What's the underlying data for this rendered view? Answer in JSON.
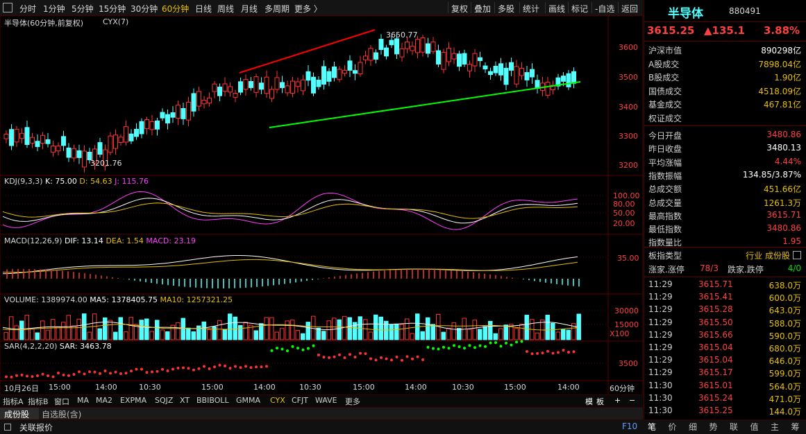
{
  "toolbar": {
    "left": [
      "分时",
      "1分钟",
      "5分钟",
      "15分钟",
      "30分钟",
      "60分钟",
      "日线",
      "周线",
      "月线",
      "多周期",
      "更多 〉"
    ],
    "active_index": 5,
    "right": [
      "复权",
      "叠加",
      "多股",
      "统计",
      "画线",
      "标记",
      "-自选",
      "返回"
    ]
  },
  "chart": {
    "title": "半导体(60分钟,前复权)",
    "indicator": "CYX(7)",
    "high_label": "3650.77",
    "low_label": "3201.76",
    "price_ticks": [
      "3600",
      "3500",
      "3400",
      "3300",
      "3200"
    ],
    "kdj": {
      "name": "KDJ(9,3,3)",
      "k": "K: 75.00",
      "d": "D: 54.63",
      "j": "J: 115.76",
      "ticks": [
        "100.00",
        "80.00",
        "50.00",
        "20.00"
      ]
    },
    "macd": {
      "name": "MACD(12,26,9)",
      "dif": "DIF: 13.14",
      "dea": "DEA: 1.54",
      "macd": "MACD: 23.19",
      "ticks": [
        "35.00"
      ]
    },
    "volume": {
      "name": "VOLUME: 1389974.00",
      "ma5": "MA5: 1378405.75",
      "ma10": "MA10: 1257321.25",
      "ticks": [
        "30000",
        "15000"
      ],
      "unit": "X100"
    },
    "sar": {
      "name": "SAR(4,2,2,20)",
      "sar": "SAR: 3463.78",
      "ticks": [
        "3500"
      ]
    },
    "time_axis": [
      "10月26日",
      "15:00",
      "14:00",
      "10:30",
      "15:00",
      "14:00",
      "10:30",
      "15:00",
      "14:00",
      "10:30",
      "15:00",
      "14:00"
    ],
    "period_label": "60分钟",
    "colors": {
      "up": "#ff3232",
      "down": "#54ffff",
      "k": "#ffffff",
      "d": "#e8c000",
      "j": "#ff40ff",
      "red_line": "#ff0000",
      "green_line": "#00ff00"
    }
  },
  "indicator_tabs": [
    "指标A",
    "指标B",
    "窗口",
    "MA",
    "MA2",
    "EXPMA",
    "SQJZ",
    "XT",
    "BBIBOLL",
    "GMMA",
    "CYX",
    "CFJT",
    "WAVE",
    "更多"
  ],
  "indicator_active": 10,
  "indicator_right": [
    "模",
    "板",
    "+",
    "−"
  ],
  "stock_tabs": [
    "成份股",
    "自选股(含)"
  ],
  "status": {
    "label": "关联报价",
    "f10": "F10"
  },
  "panel": {
    "name": "半导体",
    "code": "880491",
    "price": "3615.25",
    "change": "▲135.1",
    "change_pct": "3.88%",
    "stats": [
      {
        "label": "沪深市值",
        "value": "890298亿",
        "color": "#ffffff"
      },
      {
        "label": "A股成交",
        "value": "7898.04亿",
        "color": "#e8c000"
      },
      {
        "label": "B股成交",
        "value": "1.90亿",
        "color": "#e8c000"
      },
      {
        "label": "国债成交",
        "value": "4518.09亿",
        "color": "#e8c000"
      },
      {
        "label": "基金成交",
        "value": "467.81亿",
        "color": "#e8c000"
      },
      {
        "label": "权证成交",
        "value": "",
        "color": "#e8c000"
      }
    ],
    "stats2": [
      {
        "label": "今日开盘",
        "value": "3480.86",
        "color": "#ff4040"
      },
      {
        "label": "昨日收盘",
        "value": "3480.13",
        "color": "#ffffff"
      },
      {
        "label": "平均涨幅",
        "value": "4.44%",
        "color": "#ff4040"
      },
      {
        "label": "指数振幅",
        "value": "134.85/3.87%",
        "color": "#ffffff"
      },
      {
        "label": "总成交额",
        "value": "451.66亿",
        "color": "#e8c000"
      },
      {
        "label": "总成交量",
        "value": "1261.3万",
        "color": "#e8c000"
      },
      {
        "label": "最高指数",
        "value": "3615.71",
        "color": "#ff4040"
      },
      {
        "label": "最低指数",
        "value": "3480.86",
        "color": "#ff4040"
      },
      {
        "label": "指数量比",
        "value": "1.95",
        "color": "#ff4040"
      }
    ],
    "board_type_label": "板指类型",
    "board_type_value": "行业 成份股",
    "rise_label": "涨家.涨停",
    "rise_value": "78/3",
    "fall_label": "跌家.跌停",
    "fall_value": "4/0",
    "ticks": [
      {
        "time": "11:29",
        "price": "3615.71",
        "vol": "638.0万"
      },
      {
        "time": "11:29",
        "price": "3615.41",
        "vol": "600.0万"
      },
      {
        "time": "11:29",
        "price": "3615.28",
        "vol": "643.0万"
      },
      {
        "time": "11:29",
        "price": "3615.50",
        "vol": "588.0万"
      },
      {
        "time": "11:29",
        "price": "3615.66",
        "vol": "590.0万"
      },
      {
        "time": "11:29",
        "price": "3615.04",
        "vol": "680.0万"
      },
      {
        "time": "11:29",
        "price": "3615.04",
        "vol": "646.0万"
      },
      {
        "time": "11:29",
        "price": "3615.17",
        "vol": "599.0万"
      },
      {
        "time": "11:30",
        "price": "3615.01",
        "vol": "564.0万"
      },
      {
        "time": "11:30",
        "price": "3615.24",
        "vol": "471.0万"
      },
      {
        "time": "11:30",
        "price": "3615.25",
        "vol": "144.0万"
      }
    ],
    "bottom_tabs": [
      "笔",
      "价",
      "细",
      "势",
      "联",
      "值",
      "主",
      "筹"
    ]
  }
}
